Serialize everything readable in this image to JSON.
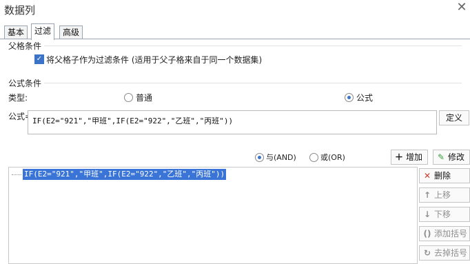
{
  "window": {
    "title": "数据列"
  },
  "tabs": [
    {
      "label": "基本"
    },
    {
      "label": "过滤"
    },
    {
      "label": "高级"
    }
  ],
  "parent_cell": {
    "section_label": "父格条件",
    "checkbox_label": "将父格子作为过滤条件 (适用于父子格来自于同一个数据集)",
    "checked": true
  },
  "formula_condition": {
    "section_label": "公式条件",
    "type_label": "类型:",
    "radio_normal": "普通",
    "radio_formula": "公式",
    "selected": "公式",
    "formula_label": "公式=",
    "formula_value": "IF(E2=\"921\",\"甲班\",IF(E2=\"922\",\"乙班\",\"丙班\"))",
    "define_button": "定义"
  },
  "logic": {
    "and_label": "与(AND)",
    "or_label": "或(OR)",
    "selected": "与(AND)",
    "add_button": "增加",
    "modify_button": "修改"
  },
  "condition_list": [
    "IF(E2=\"921\",\"甲班\",IF(E2=\"922\",\"乙班\",\"丙班\"))"
  ],
  "side_buttons": {
    "delete": "删除",
    "move_up": "上移",
    "move_down": "下移",
    "add_bracket": "添加括号",
    "remove_bracket": "去掉括号"
  },
  "colors": {
    "accent": "#3b73c8",
    "selection": "#3a74d6",
    "delete_icon": "#d23b2f",
    "modify_icon": "#3a9a3a"
  }
}
